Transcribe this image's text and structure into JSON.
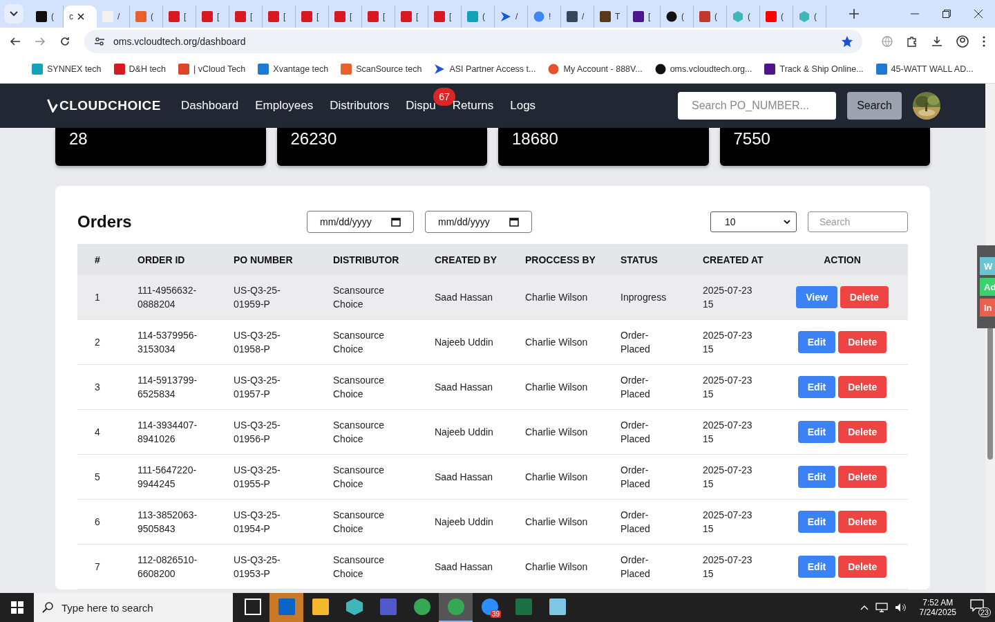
{
  "browser": {
    "tabs": [
      {
        "kind": "amazon",
        "label": "(",
        "selected": false
      },
      {
        "kind": "blank",
        "label": "c",
        "selected": true
      },
      {
        "kind": "amazonlight",
        "label": "/",
        "selected": false
      },
      {
        "kind": "scansource",
        "label": "(",
        "selected": false
      },
      {
        "kind": "dh",
        "label": "[",
        "selected": false
      },
      {
        "kind": "dh",
        "label": "[",
        "selected": false
      },
      {
        "kind": "dh",
        "label": "[",
        "selected": false
      },
      {
        "kind": "dh",
        "label": "[",
        "selected": false
      },
      {
        "kind": "dh",
        "label": "[",
        "selected": false
      },
      {
        "kind": "dh",
        "label": "[",
        "selected": false
      },
      {
        "kind": "dh",
        "label": "[",
        "selected": false
      },
      {
        "kind": "dh",
        "label": "[",
        "selected": false
      },
      {
        "kind": "dh",
        "label": "[",
        "selected": false
      },
      {
        "kind": "ec",
        "label": "(",
        "selected": false
      },
      {
        "kind": "arrow",
        "label": "/",
        "selected": false
      },
      {
        "kind": "google",
        "label": "!",
        "selected": false
      },
      {
        "kind": "adark",
        "label": "/",
        "selected": false
      },
      {
        "kind": "ups",
        "label": "T",
        "selected": false
      },
      {
        "kind": "fedex",
        "label": "[",
        "selected": false
      },
      {
        "kind": "chatgpt",
        "label": "(",
        "selected": false
      },
      {
        "kind": "toy",
        "label": "(",
        "selected": false
      },
      {
        "kind": "hex",
        "label": "(",
        "selected": false
      },
      {
        "kind": "youtube",
        "label": "(",
        "selected": false
      },
      {
        "kind": "hex",
        "label": "(",
        "selected": false
      }
    ],
    "url": "oms.vcloudtech.org/dashboard",
    "bookmarks": [
      {
        "kind": "ec",
        "label": "SYNNEX tech"
      },
      {
        "kind": "dh",
        "label": "D&H tech"
      },
      {
        "kind": "vcloud",
        "label": "| vCloud Tech"
      },
      {
        "kind": "xvantage",
        "label": "Xvantage tech"
      },
      {
        "kind": "scansource",
        "label": "ScanSource tech"
      },
      {
        "kind": "arrow",
        "label": "ASI Partner Access t..."
      },
      {
        "kind": "rings",
        "label": "My Account - 888V..."
      },
      {
        "kind": "triangle",
        "label": "oms.vcloudtech.org..."
      },
      {
        "kind": "fedex",
        "label": "Track & Ship Online..."
      },
      {
        "kind": "xvantage",
        "label": "45-WATT WALL AD..."
      }
    ]
  },
  "navbar": {
    "logo": "CLOUDCHOICE",
    "links": [
      {
        "label": "Dashboard"
      },
      {
        "label": "Employees"
      },
      {
        "label": "Distributors"
      },
      {
        "label": "Dispu",
        "badge": "67"
      },
      {
        "label": "Returns"
      },
      {
        "label": "Logs"
      }
    ],
    "search_placeholder": "Search PO_NUMBER...",
    "search_button": "Search"
  },
  "stat_cards": [
    {
      "value": "28"
    },
    {
      "value": "26230"
    },
    {
      "value": "18680"
    },
    {
      "value": "7550"
    }
  ],
  "orders": {
    "title": "Orders",
    "date_from": "mm/dd/yyyy",
    "date_to": "mm/dd/yyyy",
    "page_size": "10",
    "search_placeholder": "Search",
    "columns": [
      "#",
      "ORDER ID",
      "PO NUMBER",
      "DISTRIBUTOR",
      "CREATED BY",
      "PROCCESS BY",
      "STATUS",
      "CREATED AT",
      "ACTION"
    ],
    "rows": [
      {
        "selected": true,
        "cells": [
          "1",
          "111-4956632-0888204",
          "US-Q3-25-01959-P",
          "Scansource Choice",
          "Saad Hassan",
          "Charlie Wilson",
          "Inprogress",
          "2025-07-23 15"
        ],
        "actions": [
          {
            "label": "View",
            "kind": "primary"
          },
          {
            "label": "Delete",
            "kind": "danger"
          }
        ]
      },
      {
        "selected": false,
        "cells": [
          "2",
          "114-5379956-3153034",
          "US-Q3-25-01958-P",
          "Scansource Choice",
          "Najeeb Uddin",
          "Charlie Wilson",
          "Order-Placed",
          "2025-07-23 15"
        ],
        "actions": [
          {
            "label": "Edit",
            "kind": "primary"
          },
          {
            "label": "Delete",
            "kind": "danger"
          }
        ]
      },
      {
        "selected": false,
        "cells": [
          "3",
          "114-5913799-6525834",
          "US-Q3-25-01957-P",
          "Scansource Choice",
          "Saad Hassan",
          "Charlie Wilson",
          "Order-Placed",
          "2025-07-23 15"
        ],
        "actions": [
          {
            "label": "Edit",
            "kind": "primary"
          },
          {
            "label": "Delete",
            "kind": "danger"
          }
        ]
      },
      {
        "selected": false,
        "cells": [
          "4",
          "114-3934407-8941026",
          "US-Q3-25-01956-P",
          "Scansource Choice",
          "Najeeb Uddin",
          "Charlie Wilson",
          "Order-Placed",
          "2025-07-23 15"
        ],
        "actions": [
          {
            "label": "Edit",
            "kind": "primary"
          },
          {
            "label": "Delete",
            "kind": "danger"
          }
        ]
      },
      {
        "selected": false,
        "cells": [
          "5",
          "111-5647220-9944245",
          "US-Q3-25-01955-P",
          "Scansource Choice",
          "Saad Hassan",
          "Charlie Wilson",
          "Order-Placed",
          "2025-07-23 15"
        ],
        "actions": [
          {
            "label": "Edit",
            "kind": "primary"
          },
          {
            "label": "Delete",
            "kind": "danger"
          }
        ]
      },
      {
        "selected": false,
        "cells": [
          "6",
          "113-3852063-9505843",
          "US-Q3-25-01954-P",
          "Scansource Choice",
          "Najeeb Uddin",
          "Charlie Wilson",
          "Order-Placed",
          "2025-07-23 15"
        ],
        "actions": [
          {
            "label": "Edit",
            "kind": "primary"
          },
          {
            "label": "Delete",
            "kind": "danger"
          }
        ]
      },
      {
        "selected": false,
        "cells": [
          "7",
          "112-0826510-6608200",
          "US-Q3-25-01953-P",
          "Scansource Choice",
          "Saad Hassan",
          "Charlie Wilson",
          "Order-Placed",
          "2025-07-23 15"
        ],
        "actions": [
          {
            "label": "Edit",
            "kind": "primary"
          },
          {
            "label": "Delete",
            "kind": "danger"
          }
        ]
      }
    ]
  },
  "side_tabs": [
    {
      "label": "W",
      "color": "#6cc4d2"
    },
    {
      "label": "Ad",
      "color": "#3ecf6e"
    },
    {
      "label": "In",
      "color": "#e8604f"
    }
  ],
  "taskbar": {
    "search_placeholder": "Type here to search",
    "apps": [
      {
        "kind": "taskview",
        "attention": false,
        "selected": false
      },
      {
        "kind": "outlook",
        "attention": true,
        "selected": false
      },
      {
        "kind": "folder",
        "attention": false,
        "selected": false
      },
      {
        "kind": "hex",
        "attention": false,
        "selected": false
      },
      {
        "kind": "teams",
        "attention": false,
        "selected": false
      },
      {
        "kind": "chrome",
        "attention": false,
        "selected": false
      },
      {
        "kind": "chrome",
        "attention": false,
        "selected": true
      },
      {
        "kind": "zoom",
        "attention": false,
        "selected": false,
        "badge": "39"
      },
      {
        "kind": "excel",
        "attention": false,
        "selected": false
      },
      {
        "kind": "notepad",
        "attention": false,
        "selected": false
      }
    ],
    "time": "7:52 AM",
    "date": "7/24/2025",
    "notifications": "23"
  }
}
